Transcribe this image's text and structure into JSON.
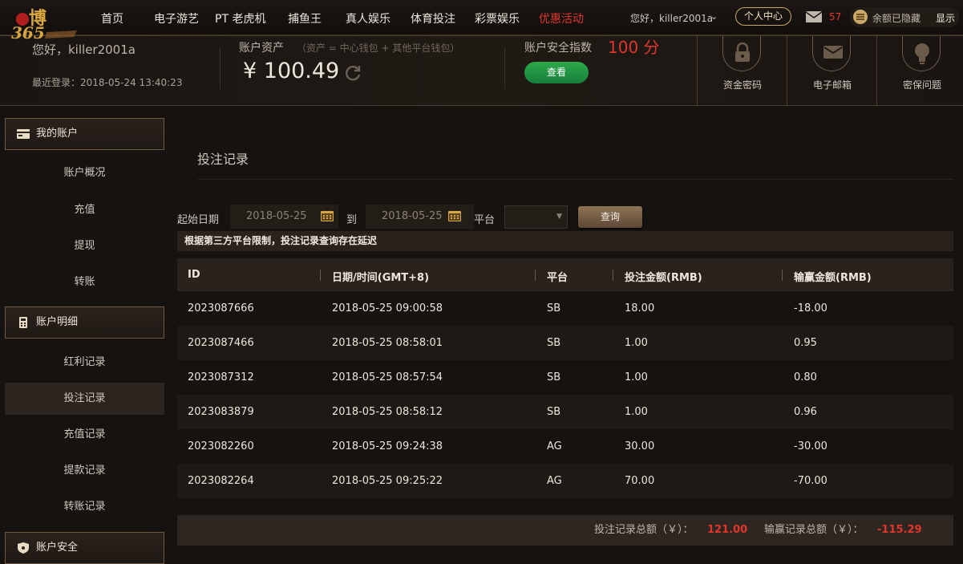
{
  "nav": {
    "logo_text": "博365",
    "items": [
      "首页",
      "电子游艺",
      "PT 老虎机",
      "捕鱼王",
      "真人娱乐",
      "体育投注",
      "彩票娱乐",
      "优惠活动"
    ],
    "greeting": "您好，killer2001a",
    "personal_center": "个人中心",
    "mail_count": "57",
    "balance_hidden": "余额已隐藏",
    "show": "显示"
  },
  "account": {
    "hello": "您好，killer2001a",
    "last_login": "最近登录：2018-05-24 13:40:23",
    "assets_label": "账户资产",
    "assets_note": "（资产 = 中心钱包 + 其他平台钱包）",
    "assets_value": "¥ 100.49",
    "security_label": "账户安全指数",
    "security_score": "100 分",
    "view_button": "查看",
    "security_items": [
      "资金密码",
      "电子邮箱",
      "密保问题"
    ]
  },
  "sidebar": {
    "sections": [
      {
        "title": "我的账户",
        "items": [
          "账户概况",
          "充值",
          "提现",
          "转账"
        ]
      },
      {
        "title": "账户明细",
        "items": [
          "红利记录",
          "投注记录",
          "充值记录",
          "提款记录",
          "转账记录"
        ]
      },
      {
        "title": "账户安全"
      }
    ],
    "active_item": "投注记录"
  },
  "main": {
    "title": "投注记录",
    "filter": {
      "start_label": "起始日期",
      "start_value": "2018-05-25",
      "to_label": "到",
      "end_value": "2018-05-25",
      "platform_label": "平台",
      "platform_value": "",
      "query_button": "查询"
    },
    "notice": "根据第三方平台限制，投注记录查询存在延迟",
    "table": {
      "headers": [
        "ID",
        "日期/时间(GMT+8)",
        "平台",
        "投注金额(RMB)",
        "输赢金额(RMB)"
      ],
      "rows": [
        [
          "2023087666",
          "2018-05-25 09:00:58",
          "SB",
          "18.00",
          "-18.00"
        ],
        [
          "2023087466",
          "2018-05-25 08:58:01",
          "SB",
          "1.00",
          "0.95"
        ],
        [
          "2023087312",
          "2018-05-25 08:57:54",
          "SB",
          "1.00",
          "0.80"
        ],
        [
          "2023083879",
          "2018-05-25 08:58:12",
          "SB",
          "1.00",
          "0.96"
        ],
        [
          "2023082260",
          "2018-05-25 09:24:38",
          "AG",
          "30.00",
          "-30.00"
        ],
        [
          "2023082264",
          "2018-05-25 09:25:22",
          "AG",
          "70.00",
          "-70.00"
        ]
      ]
    },
    "totals": {
      "bet_label": "投注记录总额（￥）：",
      "bet_value": "121.00",
      "win_label": "输赢记录总额（￥）：",
      "win_value": "-115.29"
    }
  },
  "colors": {
    "accent_red": "#e0362c",
    "gold": "#c9a86a",
    "green": "#1f9a45"
  }
}
